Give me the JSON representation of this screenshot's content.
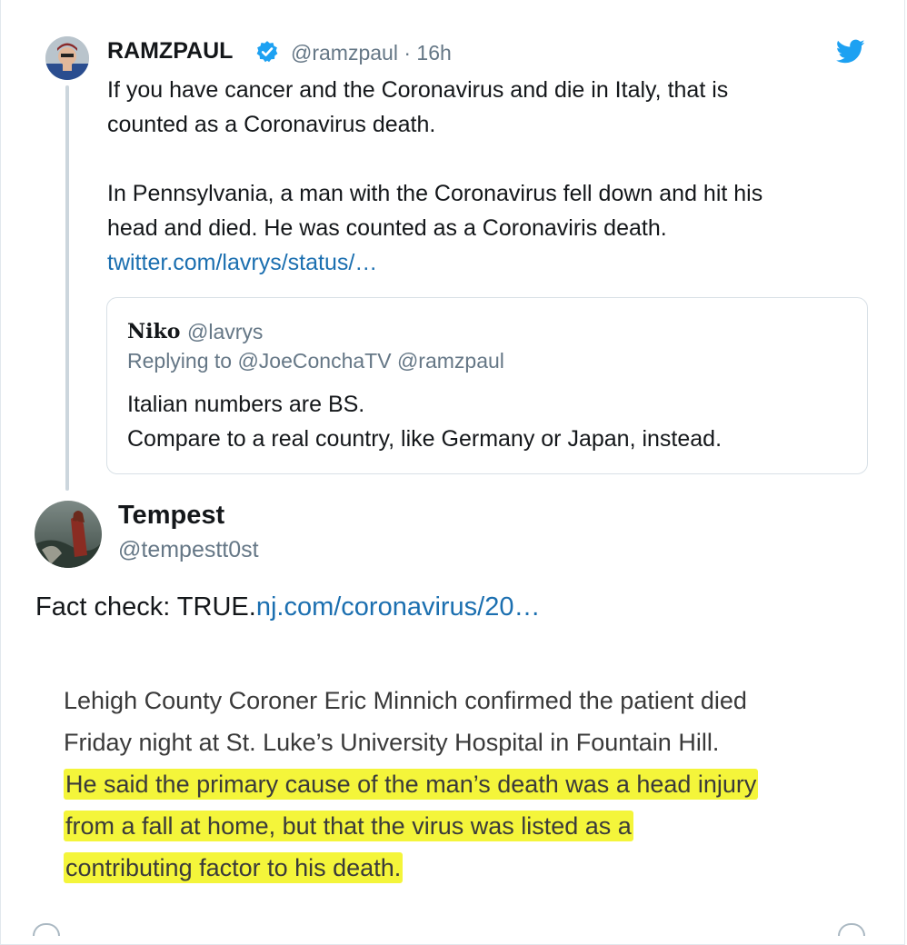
{
  "parent_tweet": {
    "name": "RAMZPAUL",
    "handle": "@ramzpaul",
    "separator": "·",
    "time": "16h",
    "text_line1": "If you have cancer and the Coronavirus and die in Italy, that is",
    "text_line2": "counted as a Coronavirus death.",
    "text_line3": "In Pennsylvania, a man with the Coronavirus fell down and hit his",
    "text_line4": "head and died. He was counted as a Coronaviris death.",
    "link": "twitter.com/lavrys/status/…",
    "icons": {
      "verified": "verified-badge-icon",
      "brand": "twitter-bird-icon"
    },
    "colors": {
      "link": "#1b6fb0",
      "verified": "#1da1f2",
      "brand": "#1da1f2",
      "muted": "#657786"
    }
  },
  "quoted_tweet": {
    "name": "Niko",
    "handle": "@lavrys",
    "replying_to": "Replying to @JoeConchaTV @ramzpaul",
    "text_line1": "Italian numbers are BS.",
    "text_line2": "Compare to a real country, like Germany or Japan, instead."
  },
  "reply_tweet": {
    "name": "Tempest",
    "handle": "@tempestt0st",
    "text_prefix": "Fact check:  TRUE.",
    "link": "nj.com/coronavirus/20…"
  },
  "article_excerpt": {
    "line1": "Lehigh County Coroner Eric Minnich confirmed the patient died",
    "line2": "Friday night at St. Luke’s University Hospital in Fountain Hill.",
    "highlight_line1": "He said the primary cause of the man’s death was a head injury",
    "highlight_line2": "from a fall at home, but that the virus was listed as a",
    "highlight_line3": "contributing factor to his death.",
    "highlight_color": "#f4f53a"
  }
}
